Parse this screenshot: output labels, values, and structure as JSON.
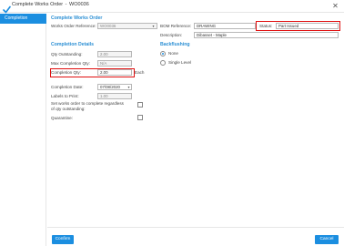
{
  "window": {
    "title": "Complete Works Order",
    "doc_number": "WO0036",
    "separator": "-"
  },
  "sidebar": {
    "items": [
      {
        "label": "Completion"
      }
    ]
  },
  "main": {
    "header": "Complete Works Order",
    "works_order_ref": {
      "label": "Works Order Reference:",
      "value": "WO0036"
    },
    "bom_ref": {
      "label": "BOM Reference:",
      "value": "DRAWING"
    },
    "status": {
      "label": "Status:",
      "value": "Part Issued"
    },
    "description": {
      "label": "Description:",
      "value": "Dibasset - Maple"
    },
    "completion_details": {
      "header": "Completion Details",
      "qty_outstanding": {
        "label": "Qty Outstanding:",
        "value": "2.00"
      },
      "max_completion_qty": {
        "label": "Max Completion Qty:",
        "value": "N/A"
      },
      "completion_qty": {
        "label": "Completion Qty:",
        "value": "2.00",
        "unit": "Each"
      },
      "completion_date": {
        "label": "Completion Date:",
        "value": "07/08/2020"
      },
      "labels_to_print": {
        "label": "Labels to Print:",
        "value": "1.00"
      },
      "set_works_order": {
        "label": "Set works order to complete regardless of qty outstanding:"
      },
      "quarantine": {
        "label": "Quarantine:"
      }
    },
    "backflushing": {
      "header": "Backflushing",
      "options": [
        {
          "label": "None",
          "selected": true
        },
        {
          "label": "Single Level",
          "selected": false
        }
      ]
    }
  },
  "footer": {
    "confirm_label": "Confirm",
    "cancel_label": "Cancel"
  },
  "colors": {
    "accent": "#1b8ee0",
    "header_text": "#2b8fd4",
    "highlight": "#e01010"
  },
  "icons": {
    "app": "check-flag-icon",
    "close": "close-icon",
    "dropdown": "chevron-down-icon"
  }
}
